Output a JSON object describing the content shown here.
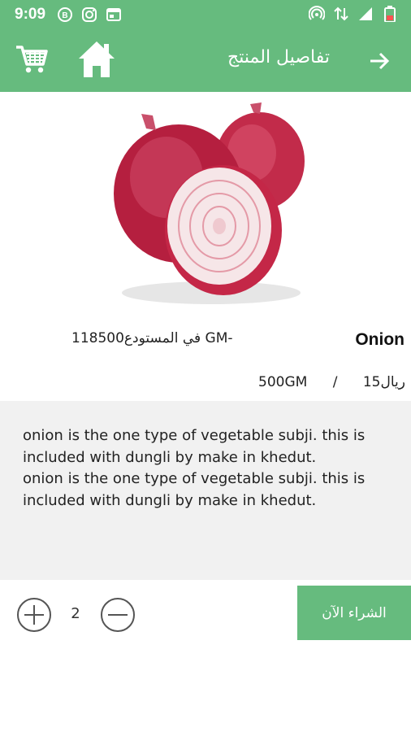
{
  "status_bar": {
    "time": "9:09",
    "icons_left": [
      "b-badge-icon",
      "instagram-icon",
      "calendar-icon"
    ],
    "icons_right": [
      "hotspot-icon",
      "data-arrows-icon",
      "signal-icon",
      "battery-icon"
    ]
  },
  "app_bar": {
    "title": "تفاصيل المنتج",
    "cart_icon": "cart-icon",
    "home_icon": "home-icon",
    "back_icon": "arrow-right-icon",
    "background": "#66bb7e"
  },
  "product": {
    "name": "Onion",
    "stock": "في المستودع118500 GM-",
    "price": "ريال15",
    "price_separator": "/",
    "unit": "500GM",
    "description": "onion is the one type of vegetable subji. this is included with dungli by make in khedut.\nonion is the one type of vegetable subji. this is included with dungli by make in khedut."
  },
  "quantity": {
    "value": "2",
    "plus_icon": "plus-circle-icon",
    "minus_icon": "minus-circle-icon"
  },
  "buy_button": {
    "label": "الشراء الآن",
    "color": "#66bb7e"
  }
}
